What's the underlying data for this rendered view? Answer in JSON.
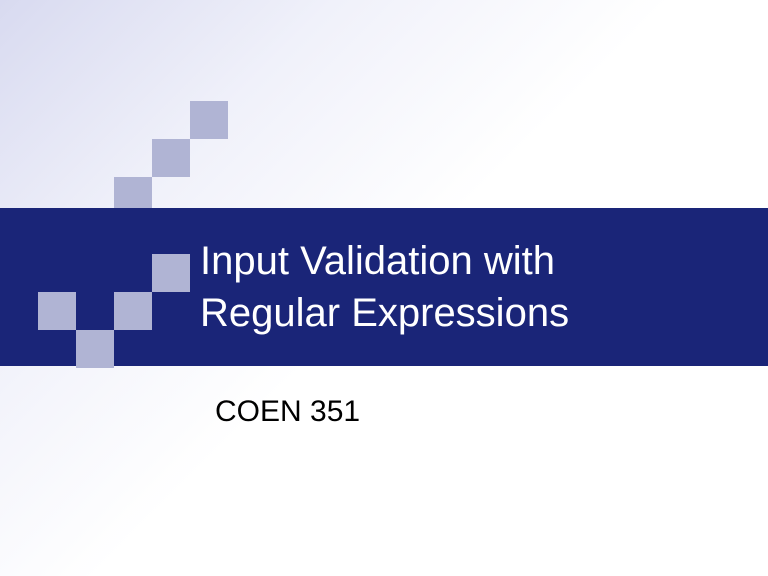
{
  "slide": {
    "title_line1": "Input Validation with",
    "title_line2": "Regular Expressions",
    "subtitle": "COEN 351"
  }
}
